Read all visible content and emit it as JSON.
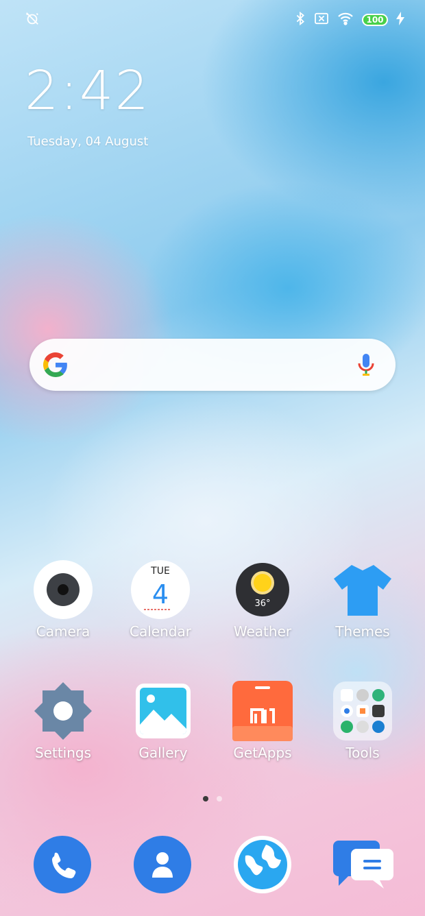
{
  "status_bar": {
    "battery_level": "100",
    "icons": [
      "alarm-off-icon",
      "bluetooth-icon",
      "sim-off-icon",
      "wifi-icon",
      "battery-icon",
      "charging-bolt-icon"
    ]
  },
  "lockscreen_widget": {
    "time": "2:42",
    "date": "Tuesday, 04 August"
  },
  "search_bar": {
    "icons": [
      "google-logo",
      "mic-icon"
    ]
  },
  "home_apps": [
    {
      "label": "Camera",
      "icon": "camera-icon"
    },
    {
      "label": "Calendar",
      "icon": "calendar-icon",
      "day_abbr": "TUE",
      "day_num": "4"
    },
    {
      "label": "Weather",
      "icon": "weather-icon",
      "temperature": "36°"
    },
    {
      "label": "Themes",
      "icon": "tshirt-icon"
    },
    {
      "label": "Settings",
      "icon": "gear-icon"
    },
    {
      "label": "Gallery",
      "icon": "gallery-icon"
    },
    {
      "label": "GetApps",
      "icon": "getapps-icon"
    },
    {
      "label": "Tools",
      "icon": "folder-icon"
    }
  ],
  "page_indicator": {
    "pages": 2,
    "current": 1
  },
  "dock": [
    {
      "icon": "phone-icon"
    },
    {
      "icon": "contacts-icon"
    },
    {
      "icon": "browser-icon"
    },
    {
      "icon": "messages-icon"
    }
  ],
  "colors": {
    "dock_blue": "#2f7de6",
    "getapps_orange": "#ff6a3d",
    "themes_blue": "#2d9df3",
    "settings_slate": "#6a87a6"
  }
}
